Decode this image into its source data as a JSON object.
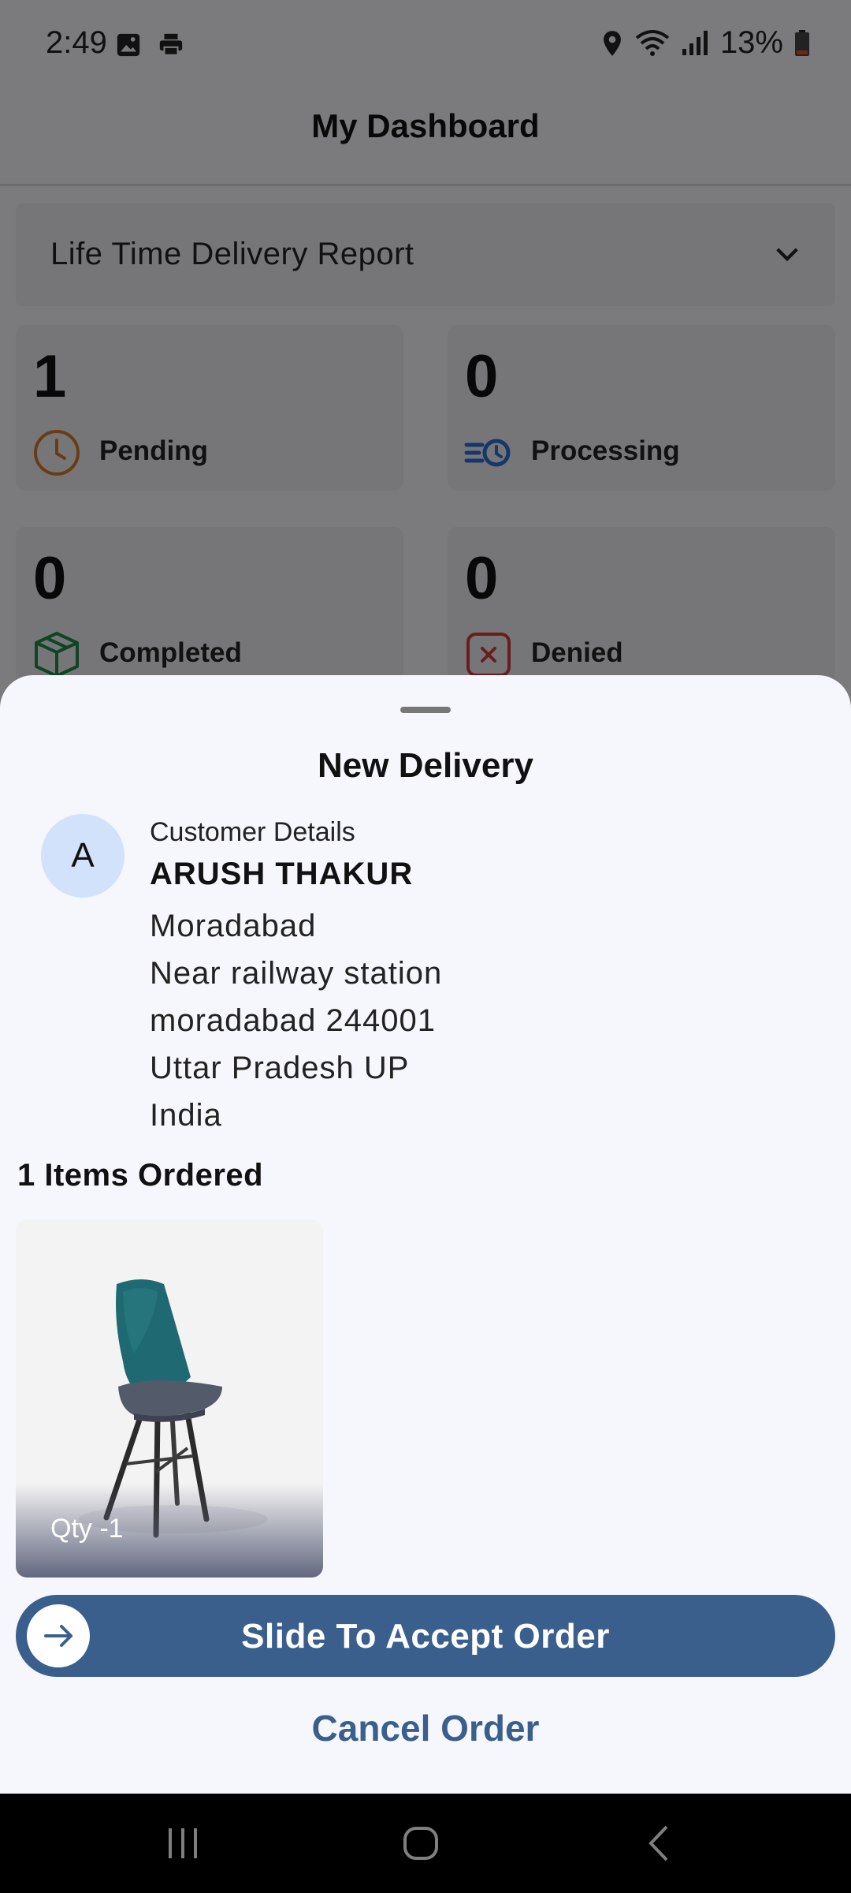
{
  "status_bar": {
    "time": "2:49",
    "battery": "13%"
  },
  "appbar": {
    "title": "My Dashboard"
  },
  "report_select": {
    "label": "Life Time Delivery Report"
  },
  "stats": [
    {
      "count": "1",
      "label": "Pending",
      "icon": "clock-icon",
      "color": "#d07a2c"
    },
    {
      "count": "0",
      "label": "Processing",
      "icon": "processing-icon",
      "color": "#2e6fd6"
    },
    {
      "count": "0",
      "label": "Completed",
      "icon": "box-icon",
      "color": "#1f8a4a"
    },
    {
      "count": "0",
      "label": "Denied",
      "icon": "close-box-icon",
      "color": "#d23b3b"
    }
  ],
  "sheet": {
    "title": "New Delivery",
    "avatar_letter": "A",
    "customer_caption": "Customer Details",
    "customer_name": "ARUSH THAKUR",
    "address_lines": [
      "Moradabad",
      "Near railway station",
      "moradabad 244001",
      "Uttar Pradesh UP",
      "India"
    ],
    "items_title": "1 Items Ordered",
    "items": [
      {
        "qty_label": "Qty  -1",
        "image": "teal-chair"
      }
    ],
    "slide_label": "Slide To Accept Order",
    "cancel_label": "Cancel Order"
  },
  "colors": {
    "accent": "#3b5f8c",
    "avatar_bg": "#d3e2fb"
  }
}
